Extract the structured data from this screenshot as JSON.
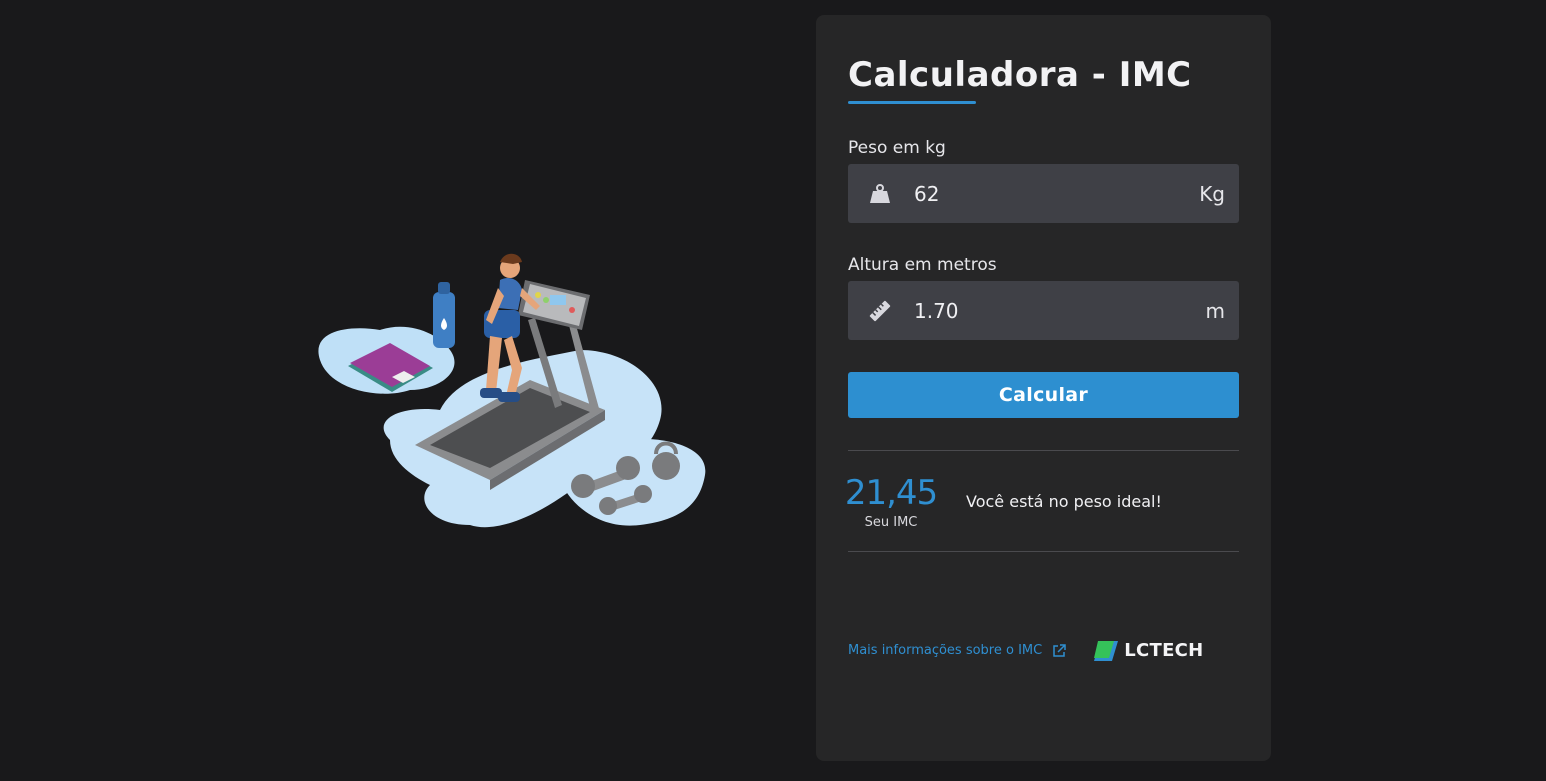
{
  "illustration": {
    "name": "fitness-treadmill-illustration"
  },
  "card": {
    "title": "Calculadora - IMC",
    "weight": {
      "label": "Peso em kg",
      "value": "62",
      "unit": "Kg",
      "icon": "weight-icon"
    },
    "height": {
      "label": "Altura em metros",
      "value": "1.70",
      "unit": "m",
      "icon": "ruler-icon"
    },
    "button_label": "Calcular",
    "result": {
      "value": "21,45",
      "caption": "Seu IMC",
      "message": "Você está no peso ideal!"
    },
    "footer": {
      "link_text": "Mais informações sobre o IMC",
      "brand": "LCTECH"
    }
  },
  "colors": {
    "accent": "#2f8fd1",
    "background": "#19191b",
    "card": "#262627",
    "input": "#3f4046"
  }
}
